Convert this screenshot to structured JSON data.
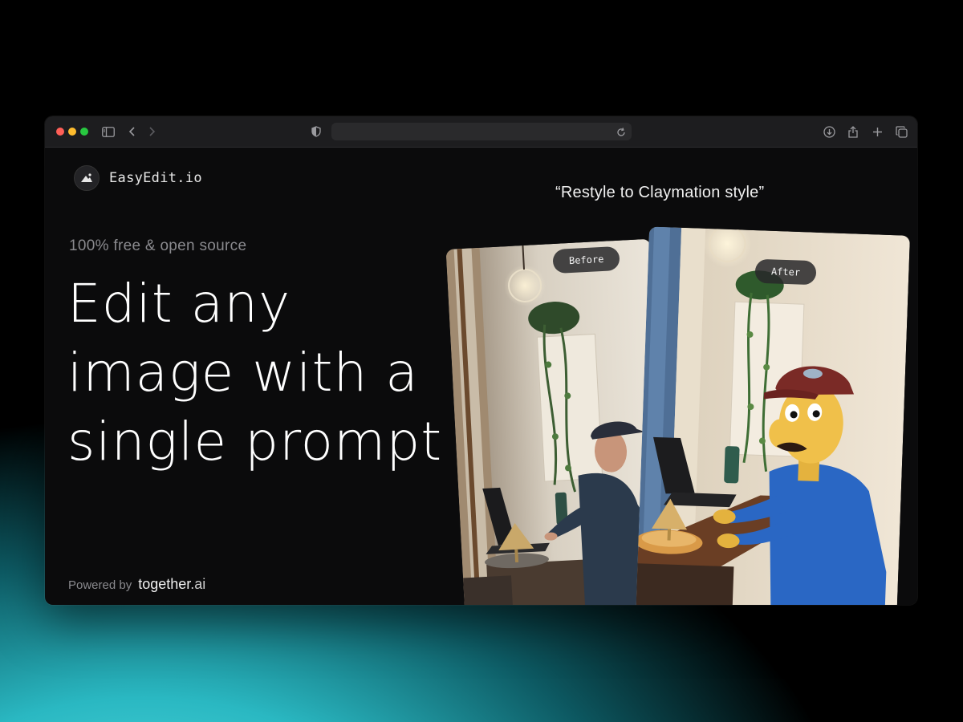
{
  "app": {
    "brand_name": "EasyEdit.io",
    "tagline": "100% free & open source",
    "headline": "Edit any image with a single prompt",
    "powered_by_label": "Powered by",
    "powered_by_brand": "together",
    "powered_by_brand_suffix": ".ai"
  },
  "demo": {
    "prompt_caption": "“Restyle to Claymation style”",
    "before_label": "Before",
    "after_label": "After"
  },
  "browser": {
    "address": ""
  },
  "icons": {
    "close": "traffic-light-red",
    "minimize": "traffic-light-yellow",
    "zoom": "traffic-light-green",
    "sidebar": "sidebar-icon",
    "back": "chevron-left-icon",
    "forward": "chevron-right-icon",
    "privacy": "shield-icon",
    "reload": "reload-icon",
    "download": "download-icon",
    "share": "share-icon",
    "new_tab": "plus-icon",
    "tabs": "tabs-overview-icon"
  },
  "colors": {
    "background_accent": "#2ab8c2",
    "window_bg": "#0b0b0c",
    "chrome_bg": "#1d1d1f",
    "text_primary": "#ffffff",
    "text_muted": "#8a8a8e"
  }
}
